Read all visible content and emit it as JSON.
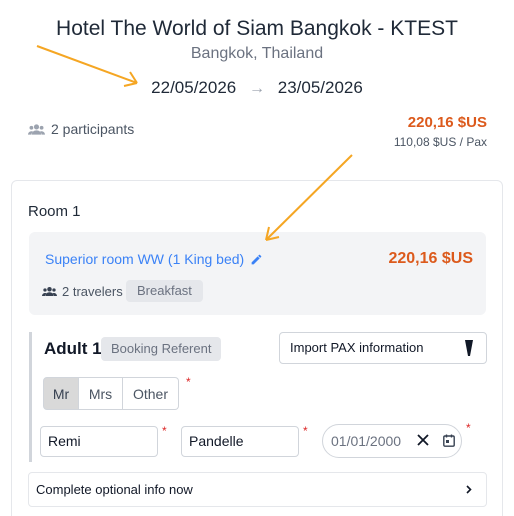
{
  "hotel": {
    "name": "Hotel The World of Siam Bangkok - KTEST",
    "location": "Bangkok, Thailand",
    "check_in": "22/05/2026",
    "check_out": "23/05/2026",
    "date_arrow_icon": "arrow-right-icon"
  },
  "summary": {
    "participants_icon": "users-icon",
    "participants": "2 participants",
    "total_price": "220,16 $US",
    "price_per_pax": "110,08 $US / Pax"
  },
  "room": {
    "title": "Room 1",
    "name": "Superior room WW (1 King bed)",
    "edit_icon": "pencil-icon",
    "price": "220,16 $US",
    "travelers_icon": "users-icon",
    "travelers": "2 travelers",
    "board": "Breakfast"
  },
  "adult": {
    "title": "Adult 1",
    "role_badge": "Booking Referent",
    "import_select": "Import PAX information",
    "salutations": [
      "Mr",
      "Mrs",
      "Other"
    ],
    "selected_salutation": "Mr",
    "first_name": "Remi",
    "last_name": "Pandelle",
    "birth_date": "01/01/2000",
    "required_mark": "*",
    "optional_info": "Complete optional info now"
  },
  "colors": {
    "price": "#dc5a1c",
    "link": "#3b82f6",
    "required": "#dc2626",
    "annotation_arrow": "#f5a623"
  }
}
